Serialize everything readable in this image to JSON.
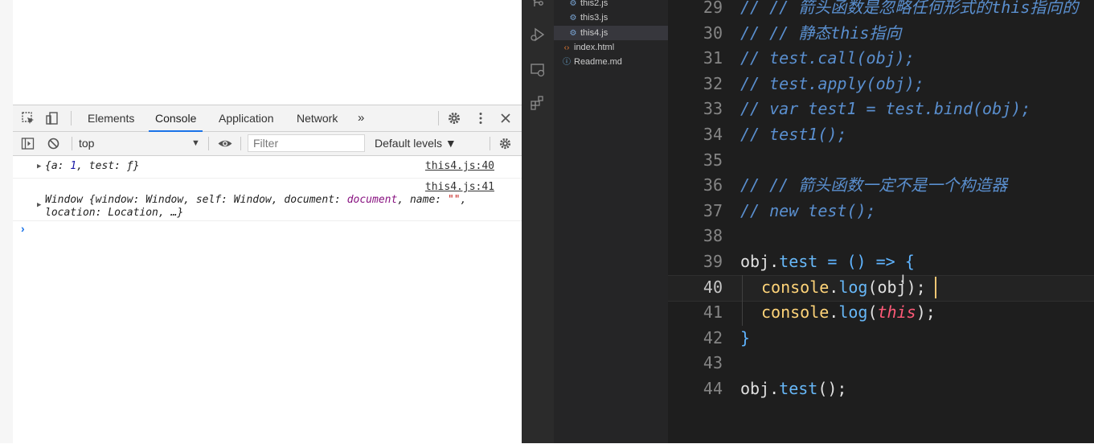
{
  "devtools": {
    "tabs": [
      "Elements",
      "Console",
      "Application",
      "Network"
    ],
    "more_tabs": "»",
    "context": "top",
    "filter_placeholder": "Filter",
    "levels": "Default levels ▼"
  },
  "console": {
    "entries": [
      {
        "source": "this4.js:40",
        "text": "{a: 1, test: ƒ}",
        "parts": {
          "open": "{a: ",
          "num": "1",
          "mid": ", test: ",
          "fn": "ƒ",
          "close": "}"
        }
      },
      {
        "source": "this4.js:41",
        "line1": {
          "a": "Window {window: Window, self: Window, document: ",
          "doc": "document",
          "b": ", name: ",
          "str": "\"\"",
          "c": ","
        },
        "line2": "location: Location, …}"
      }
    ],
    "prompt": "›"
  },
  "explorer": {
    "files": [
      {
        "name": "this2.js",
        "icon": "js"
      },
      {
        "name": "this3.js",
        "icon": "js"
      },
      {
        "name": "this4.js",
        "icon": "js",
        "selected": true
      },
      {
        "name": "index.html",
        "icon": "html"
      },
      {
        "name": "Readme.md",
        "icon": "info"
      }
    ]
  },
  "editor": {
    "active_line": 40,
    "lines": [
      {
        "n": "29",
        "t": "// // 箭头函数是忽略任何形式的this指向的"
      },
      {
        "n": "30",
        "t": "// // 静态this指向"
      },
      {
        "n": "31",
        "t": "// test.call(obj);"
      },
      {
        "n": "32",
        "t": "// test.apply(obj);"
      },
      {
        "n": "33",
        "t": "// var test1 = test.bind(obj);"
      },
      {
        "n": "34",
        "t": "// test1();"
      },
      {
        "n": "35",
        "t": ""
      },
      {
        "n": "36",
        "t": "// // 箭头函数一定不是一个构造器"
      },
      {
        "n": "37",
        "t": "// new test();"
      },
      {
        "n": "38",
        "t": ""
      },
      {
        "n": "39",
        "t": "obj.test = () => {"
      },
      {
        "n": "40",
        "t": "  console.log(obj);"
      },
      {
        "n": "41",
        "t": "  console.log(this);"
      },
      {
        "n": "42",
        "t": "}"
      },
      {
        "n": "43",
        "t": ""
      },
      {
        "n": "44",
        "t": "obj.test();"
      }
    ],
    "tokens": {
      "obj": "obj",
      "dot": ".",
      "test": "test",
      "assign": " = () => {",
      "console": "console",
      "log": "log",
      "open": "(",
      "objarg": "obj",
      "close": ");",
      "thisarg": "this",
      "brace": "}",
      "call": "();"
    }
  },
  "colors": {
    "accent_blue": "#1a73e8",
    "editor_bg": "#1e1e1e",
    "comment": "#5a8fcf",
    "this_kw": "#ff5a78"
  }
}
